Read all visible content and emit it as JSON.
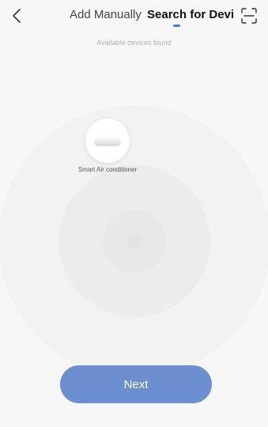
{
  "header": {
    "tab_manual": "Add Manually",
    "tab_search": "Search for Devi",
    "back_icon": "chevron-left-icon",
    "scan_icon": "scan-icon"
  },
  "status": {
    "subtitle": "Available devices found"
  },
  "device": {
    "name": "Smart Air conditioner",
    "icon": "air-conditioner-icon"
  },
  "actions": {
    "next_label": "Next"
  },
  "colors": {
    "background": "#f7f7f7",
    "accent": "#3b7fe6",
    "button": "#6c8fd2"
  }
}
